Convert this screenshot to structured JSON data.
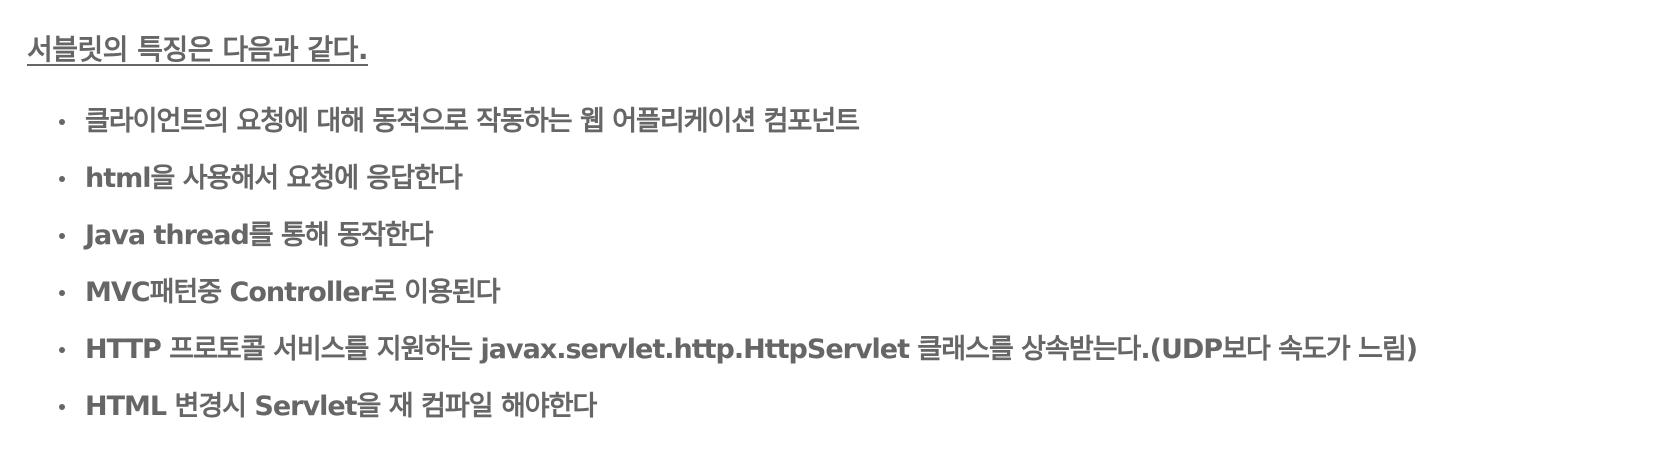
{
  "heading": "서블릿의 특징은 다음과 같다.",
  "items": [
    "클라이언트의 요청에 대해 동적으로 작동하는 웹 어플리케이션 컴포넌트",
    "html을 사용해서 요청에 응답한다",
    "Java thread를 통해 동작한다",
    "MVC패턴중 Controller로 이용된다",
    "HTTP 프로토콜 서비스를 지원하는 javax.servlet.http.HttpServlet 클래스를 상속받는다.(UDP보다 속도가 느림)",
    "HTML 변경시 Servlet을 재 컴파일 해야한다"
  ]
}
